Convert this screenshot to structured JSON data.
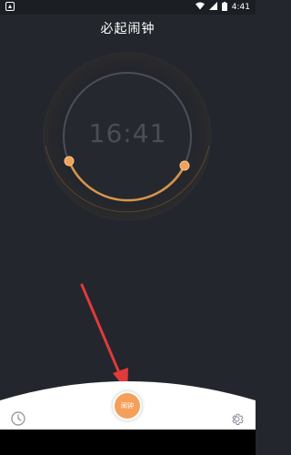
{
  "status_bar": {
    "time": "4:41",
    "icons": [
      "notification-icon",
      "wifi-icon",
      "signal-icon",
      "battery-icon"
    ]
  },
  "app": {
    "title": "必起闹钟"
  },
  "clock": {
    "time": "16:41",
    "ring_color": "#4a4e56",
    "arc_color": "#f2a24a"
  },
  "bottom_nav": {
    "alarm_button_label": "闹钟",
    "left_icon": "clock-icon",
    "right_icon": "gear-icon"
  },
  "colors": {
    "background": "#23262d",
    "accent": "#f4a05a",
    "arrow": "#e03a3a"
  }
}
